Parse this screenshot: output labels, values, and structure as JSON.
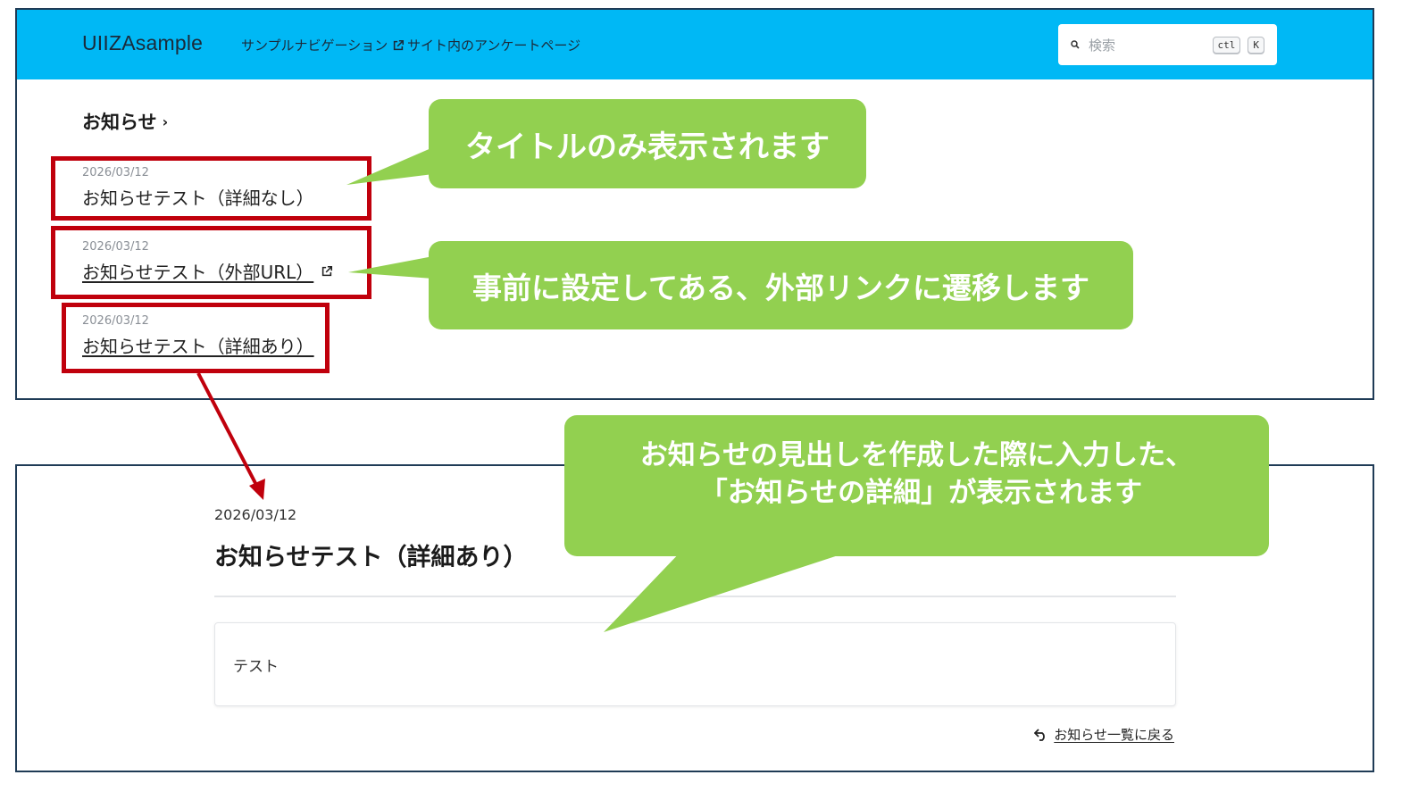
{
  "site": {
    "logo": "UIIZAsample",
    "nav": [
      {
        "label": "サンプルナビゲーション",
        "external": true
      },
      {
        "label": "サイト内のアンケートページ",
        "external": false
      }
    ],
    "search": {
      "placeholder": "検索",
      "shortcut_keys": [
        "ctl",
        "K"
      ]
    },
    "accent_color": "#00b8f5"
  },
  "news": {
    "heading": "お知らせ",
    "items": [
      {
        "date": "2026/03/12",
        "title": "お知らせテスト（詳細なし）",
        "is_link": false,
        "external": false
      },
      {
        "date": "2026/03/12",
        "title": "お知らせテスト（外部URL）",
        "is_link": true,
        "external": true
      },
      {
        "date": "2026/03/12",
        "title": "お知らせテスト（詳細あり）",
        "is_link": true,
        "external": false
      }
    ]
  },
  "detail": {
    "date": "2026/03/12",
    "title": "お知らせテスト（詳細あり）",
    "body": "テスト",
    "back_link": "お知らせ一覧に戻る"
  },
  "callouts": {
    "title_only": "タイトルのみ表示されます",
    "external": "事前に設定してある、外部リンクに遷移します",
    "detail_line1": "お知らせの見出しを作成した際に入力した、",
    "detail_line2": "「お知らせの詳細」が表示されます",
    "color": "#92d050"
  },
  "highlight_color": "#c0000c"
}
